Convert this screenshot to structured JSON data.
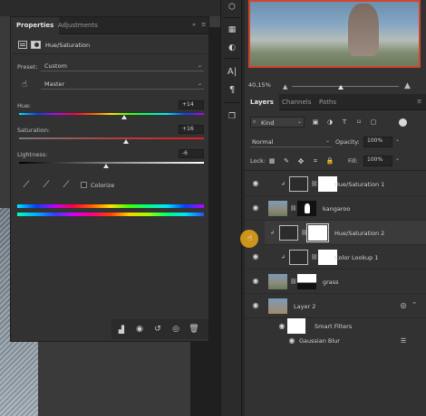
{
  "properties": {
    "tabs": [
      "Properties",
      "Adjustments"
    ],
    "collapse_glyph": "»",
    "menu_glyph": "≡",
    "adjustment_title": "Hue/Saturation",
    "preset_label": "Preset:",
    "preset_value": "Custom",
    "channel_value": "Master",
    "hue_label": "Hue:",
    "hue_value": "+14",
    "hue_level": 0.57,
    "saturation_label": "Saturation:",
    "saturation_value": "+16",
    "saturation_level": 0.58,
    "lightness_label": "Lightness:",
    "lightness_value": "-6",
    "lightness_level": 0.47,
    "colorize_label": "Colorize",
    "colorize_checked": false
  },
  "navigator": {
    "zoom": "40,15%"
  },
  "layers": {
    "tabs": [
      "Layers",
      "Channels",
      "Paths"
    ],
    "filter_kind": "Kind",
    "blend_mode": "Normal",
    "opacity_label": "Opacity:",
    "opacity_value": "100%",
    "lock_label": "Lock:",
    "fill_label": "Fill:",
    "fill_value": "100%",
    "items": [
      {
        "name": "Hue/Saturation 1",
        "type": "adjustment"
      },
      {
        "name": "kangaroo",
        "type": "image"
      },
      {
        "name": "Hue/Saturation 2",
        "type": "adjustment"
      },
      {
        "name": "Color Lookup 1",
        "type": "adjustment"
      },
      {
        "name": "grass",
        "type": "image"
      },
      {
        "name": "Layer 2",
        "type": "smart-object"
      },
      {
        "name": "Smart Filters",
        "type": "filter-group"
      },
      {
        "name": "Gaussian Blur",
        "type": "filter"
      }
    ]
  },
  "colors": {
    "accent_selection": "#d2442e",
    "cursor": "#e0a018",
    "panel_bg": "#323232"
  }
}
